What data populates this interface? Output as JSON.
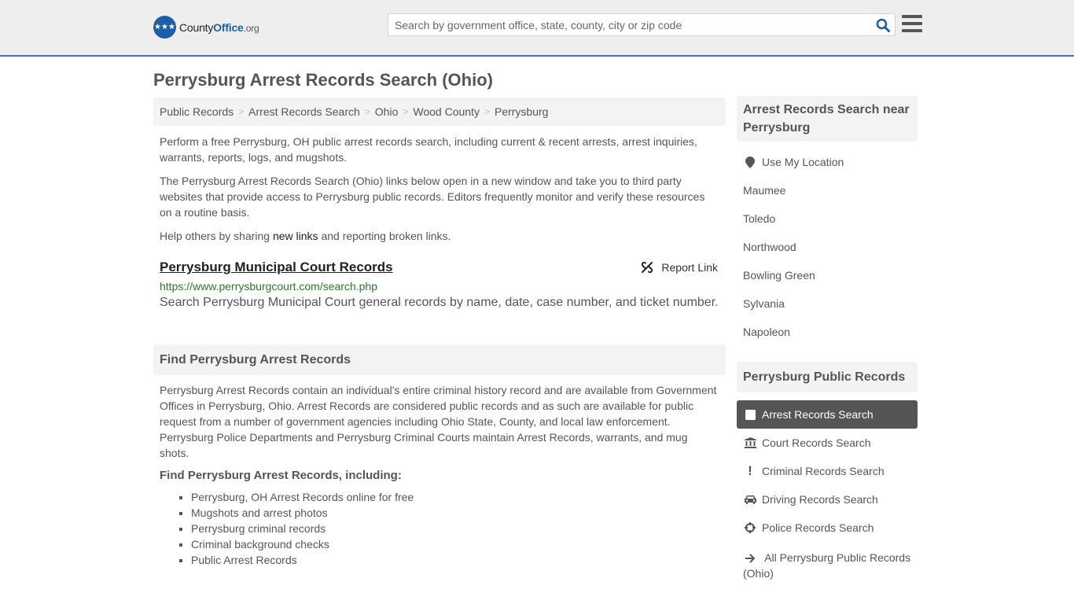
{
  "header": {
    "logo_text_main": "County",
    "logo_text_bold": "Office",
    "logo_text_tld": ".org",
    "search_placeholder": "Search by government office, state, county, city or zip code",
    "search_value": ""
  },
  "page": {
    "title": "Perrysburg Arrest Records Search (Ohio)"
  },
  "breadcrumb": [
    {
      "label": "Public Records"
    },
    {
      "label": "Arrest Records Search"
    },
    {
      "label": "Ohio"
    },
    {
      "label": "Wood County"
    },
    {
      "label": "Perrysburg"
    }
  ],
  "intro": {
    "p1": "Perform a free Perrysburg, OH public arrest records search, including current & recent arrests, arrest inquiries, warrants, reports, logs, and mugshots.",
    "p2": "The Perrysburg Arrest Records Search (Ohio) links below open in a new window and take you to third party websites that provide access to Perrysburg public records. Editors frequently monitor and verify these resources on a routine basis.",
    "p3_before": "Help others by sharing ",
    "p3_link": "new links",
    "p3_after": " and reporting broken links."
  },
  "results": [
    {
      "title": "Perrysburg Municipal Court Records",
      "url": "https://www.perrysburgcourt.com/search.php",
      "description": "Search Perrysburg Municipal Court general records by name, date, case number, and ticket number.",
      "report_label": "Report Link"
    }
  ],
  "find_section": {
    "heading": "Find Perrysburg Arrest Records",
    "body": "Perrysburg Arrest Records contain an individual's entire criminal history record and are available from Government Offices in Perrysburg, Ohio. Arrest Records are considered public records and as such are available for public request from a number of government agencies including Ohio State, County, and local law enforcement. Perrysburg Police Departments and Perrysburg Criminal Courts maintain Arrest Records, warrants, and mug shots.",
    "subheading": "Find Perrysburg Arrest Records, including:",
    "items": [
      "Perrysburg, OH Arrest Records online for free",
      "Mugshots and arrest photos",
      "Perrysburg criminal records",
      "Criminal background checks",
      "Public Arrest Records"
    ]
  },
  "sidebar": {
    "nearby_heading": "Arrest Records Search near Perrysburg",
    "use_location": "Use My Location",
    "nearby": [
      "Maumee",
      "Toledo",
      "Northwood",
      "Bowling Green",
      "Sylvania",
      "Napoleon"
    ],
    "public_records_heading": "Perrysburg Public Records",
    "public_records": [
      {
        "label": "Arrest Records Search",
        "icon": "square-icon",
        "active": true
      },
      {
        "label": "Court Records Search",
        "icon": "courthouse-icon",
        "active": false
      },
      {
        "label": "Criminal Records Search",
        "icon": "exclamation-icon",
        "active": false
      },
      {
        "label": "Driving Records Search",
        "icon": "car-icon",
        "active": false
      },
      {
        "label": "Police Records Search",
        "icon": "crosshairs-icon",
        "active": false
      },
      {
        "label": "All Perrysburg Public Records (Ohio)",
        "icon": "arrow-right-icon",
        "active": false
      }
    ]
  },
  "colors": {
    "brand_blue": "#1a5fa8",
    "header_border": "#3a7bb3",
    "url_green": "#2b7a2b",
    "active_item_bg": "#555555"
  }
}
